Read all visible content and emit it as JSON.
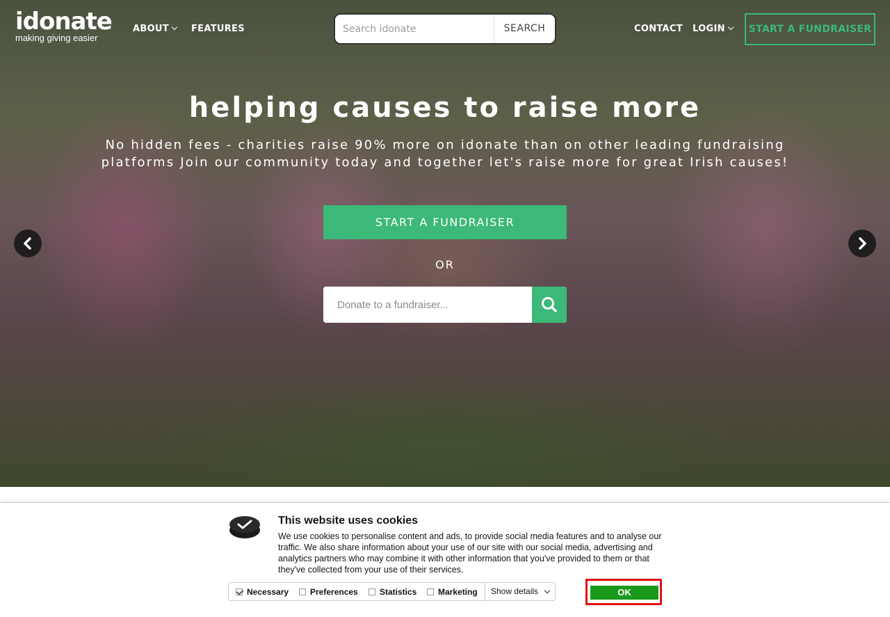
{
  "logo": {
    "word": "idonate",
    "tagline": "making giving easier"
  },
  "nav": {
    "about": "ABOUT",
    "features": "FEATURES",
    "contact": "CONTACT",
    "login": "LOGIN",
    "start_fundraiser": "START A FUNDRAISER"
  },
  "search": {
    "placeholder": "Search idonate",
    "button": "SEARCH"
  },
  "hero": {
    "title": "helping causes to raise more",
    "subtitle": "No hidden fees - charities raise 90% more on idonate than on other leading fundraising platforms Join our community today and together let's raise more for great Irish causes!",
    "cta": "START A FUNDRAISER",
    "or": "OR",
    "donate_placeholder": "Donate to a fundraiser..."
  },
  "cookie": {
    "title": "This website uses cookies",
    "body": "We use cookies to personalise content and ads, to provide social media features and to analyse our traffic. We also share information about your use of our site with our social media, advertising and analytics partners who may combine it with other information that you've provided to them or that they've collected from your use of their services.",
    "options": [
      {
        "label": "Necessary",
        "checked": true
      },
      {
        "label": "Preferences",
        "checked": false
      },
      {
        "label": "Statistics",
        "checked": false
      },
      {
        "label": "Marketing",
        "checked": false
      }
    ],
    "details": "Show details",
    "ok": "OK"
  },
  "colors": {
    "accent": "#3cb878",
    "ok_button": "#1a9a1a",
    "highlight": "#e01010"
  }
}
